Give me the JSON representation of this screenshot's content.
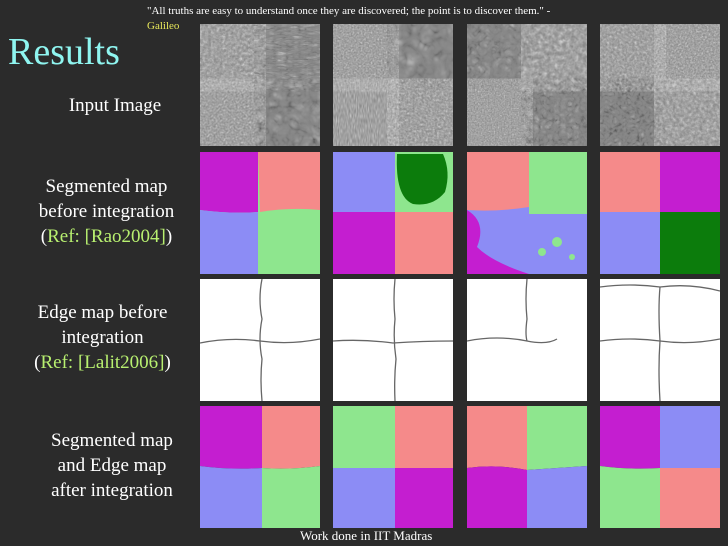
{
  "header": {
    "quote_text": "\"All truths are easy to understand once they are discovered; the point is to discover them.\" -",
    "quote_author": "Galileo"
  },
  "slide": {
    "title": "Results",
    "footer": "Work done in IIT Madras"
  },
  "rows": [
    {
      "label_lines": [
        "Input Image"
      ],
      "ref": ""
    },
    {
      "label_lines": [
        "Segmented map",
        "before integration"
      ],
      "ref_prefix": "(",
      "ref": "Ref: [Rao2004]",
      "ref_suffix": ")"
    },
    {
      "label_lines": [
        "Edge map before",
        "integration"
      ],
      "ref_prefix": "(",
      "ref": "Ref: [Lalit2006]",
      "ref_suffix": ")"
    },
    {
      "label_lines": [
        "Segmented map",
        "and Edge map",
        "after integration"
      ],
      "ref": ""
    }
  ],
  "colors": {
    "magenta": "#c41ed0",
    "salmon": "#f58a8a",
    "lavender": "#8c8cf5",
    "green": "#8ee68e",
    "dark_green": "#0c7c0c"
  }
}
